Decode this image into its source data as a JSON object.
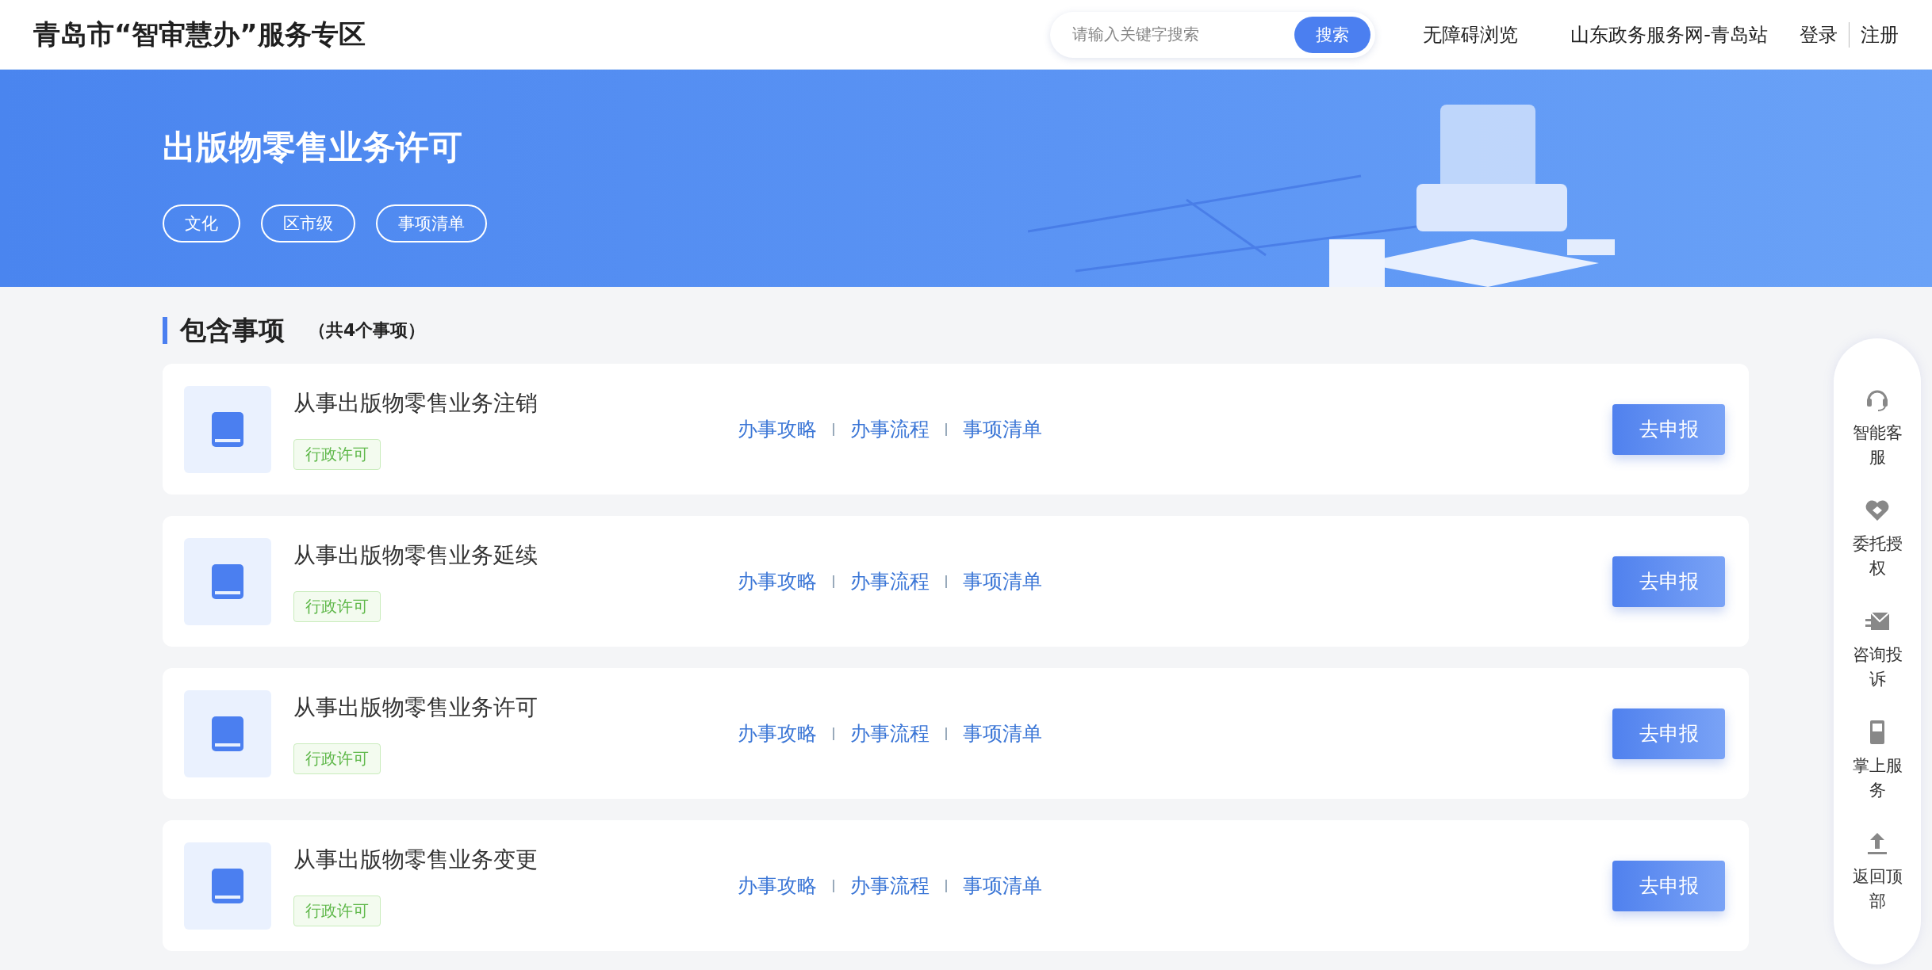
{
  "header": {
    "title": "青岛市“智审慧办”服务专区",
    "search": {
      "placeholder": "请输入关键字搜索",
      "button": "搜索"
    },
    "nav": [
      "无障碍浏览",
      "山东政务服务网-青岛站",
      "登录",
      "注册"
    ]
  },
  "banner": {
    "title": "出版物零售业务许可",
    "tags": [
      "文化",
      "区市级",
      "事项清单"
    ]
  },
  "section": {
    "title": "包含事项",
    "count": "（共4个事项）"
  },
  "items": [
    {
      "title": "从事出版物零售业务注销",
      "tag": "行政许可",
      "links": [
        "办事攻略",
        "办事流程",
        "事项清单"
      ],
      "button": "去申报"
    },
    {
      "title": "从事出版物零售业务延续",
      "tag": "行政许可",
      "links": [
        "办事攻略",
        "办事流程",
        "事项清单"
      ],
      "button": "去申报"
    },
    {
      "title": "从事出版物零售业务许可",
      "tag": "行政许可",
      "links": [
        "办事攻略",
        "办事流程",
        "事项清单"
      ],
      "button": "去申报"
    },
    {
      "title": "从事出版物零售业务变更",
      "tag": "行政许可",
      "links": [
        "办事攻略",
        "办事流程",
        "事项清单"
      ],
      "button": "去申报"
    }
  ],
  "side_panel": [
    {
      "kind": "headset",
      "label": "智能客服"
    },
    {
      "kind": "handshake",
      "label": "委托授权"
    },
    {
      "kind": "mail",
      "label": "咨询投诉"
    },
    {
      "kind": "phone",
      "label": "掌上服务"
    },
    {
      "kind": "top",
      "label": "返回顶部"
    }
  ]
}
